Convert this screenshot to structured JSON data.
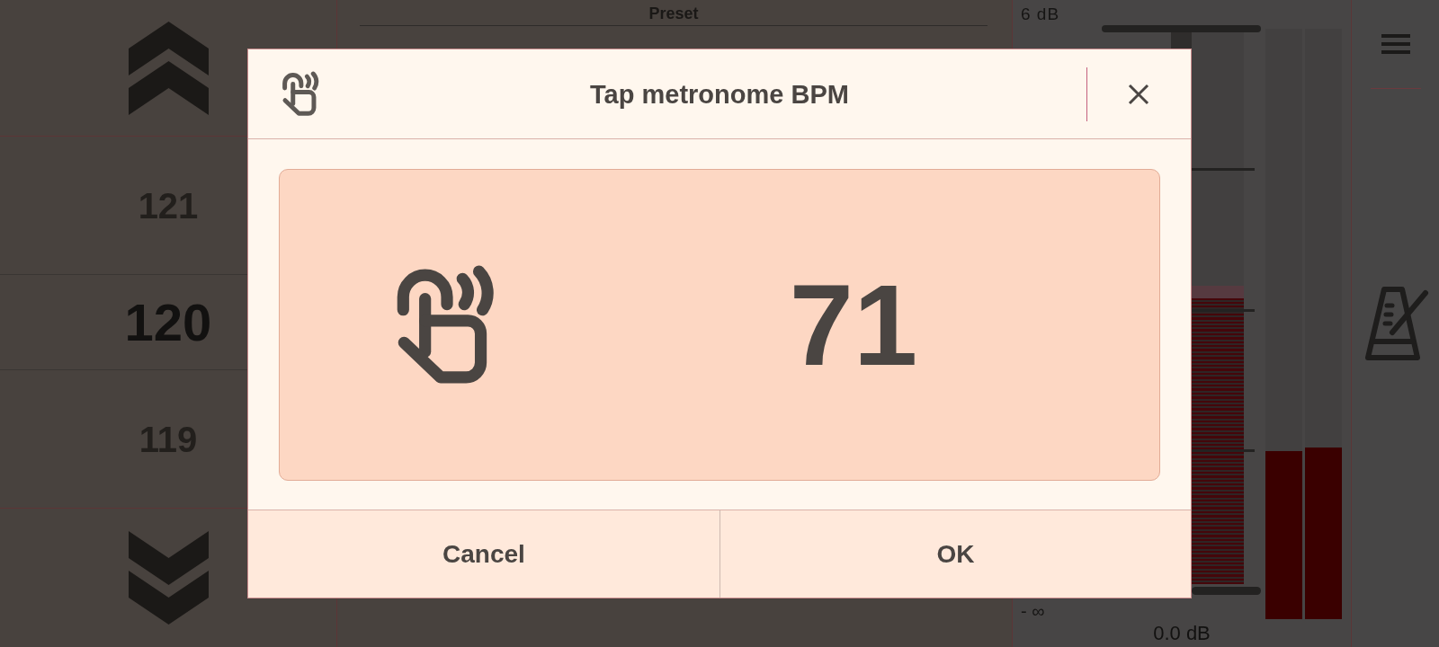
{
  "tempo_list": [
    {
      "value": "121",
      "selected": false
    },
    {
      "value": "120",
      "selected": true
    },
    {
      "value": "119",
      "selected": false
    }
  ],
  "preset_panel": {
    "title": "Preset"
  },
  "gain_meter": {
    "top_label": "6 dB",
    "gain_slider": {
      "level": 0.54
    },
    "channels": [
      {
        "level": 0.285
      },
      {
        "level": 0.29
      }
    ],
    "bottom_label": "- ∞",
    "reading": "0.0 dB"
  },
  "dialog": {
    "title": "Tap metronome BPM",
    "tap_pad": {
      "value": "71"
    },
    "buttons": [
      {
        "label": "Cancel"
      },
      {
        "label": "OK"
      }
    ]
  }
}
